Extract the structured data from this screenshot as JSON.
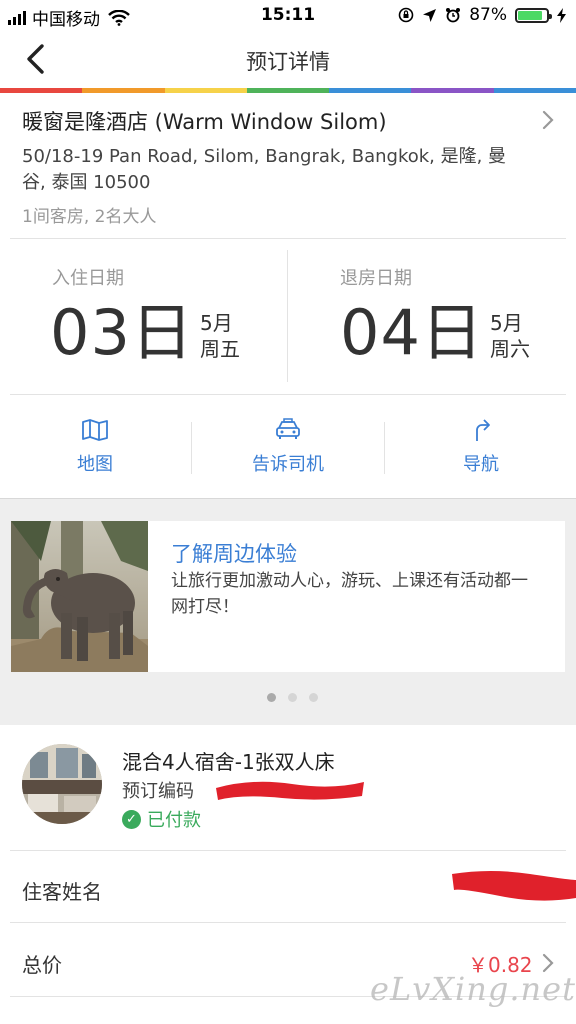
{
  "status_bar": {
    "carrier": "中国移动",
    "time": "15:11",
    "battery_percent_text": "87%",
    "battery_level": 0.87
  },
  "nav": {
    "back_icon": "chevron-left-icon",
    "title": "预订详情"
  },
  "rainbow_colors": [
    "#e8473f",
    "#f19a2a",
    "#f6d24a",
    "#4fb35a",
    "#3a8fd8",
    "#8a55c6",
    "#3a8fd8"
  ],
  "hotel": {
    "name": "暖窗是隆酒店 (Warm Window Silom)",
    "address": "50/18-19 Pan Road, Silom, Bangrak, Bangkok, 是隆, 曼谷, 泰国 10500",
    "rooms_guests": "1间客房, 2名大人"
  },
  "checkin": {
    "label": "入住日期",
    "day": "03日",
    "month": "5月",
    "weekday": "周五"
  },
  "checkout": {
    "label": "退房日期",
    "day": "04日",
    "month": "5月",
    "weekday": "周六"
  },
  "actions": [
    {
      "label": "地图",
      "icon": "map-icon"
    },
    {
      "label": "告诉司机",
      "icon": "taxi-icon"
    },
    {
      "label": "导航",
      "icon": "turn-right-arrow-icon"
    }
  ],
  "promo": {
    "title": "了解周边体验",
    "description": "让旅行更加激动人心，游玩、上课还有活动都一网打尽！",
    "image": "elephant-photo"
  },
  "carousel": {
    "count": 3,
    "active_index": 0
  },
  "booking": {
    "room_type": "混合4人宿舍-1张双人床",
    "code_label": "预订编码",
    "status": "已付款",
    "guest_label": "住客姓名",
    "total_label": "总价",
    "total_value": "￥0.82"
  },
  "watermark": "eLvXing.net",
  "colors": {
    "accent_blue": "#3a7ed4",
    "paid_green": "#3aaa5c",
    "price_red": "#e9454d",
    "redaction_red": "#e0212b"
  }
}
